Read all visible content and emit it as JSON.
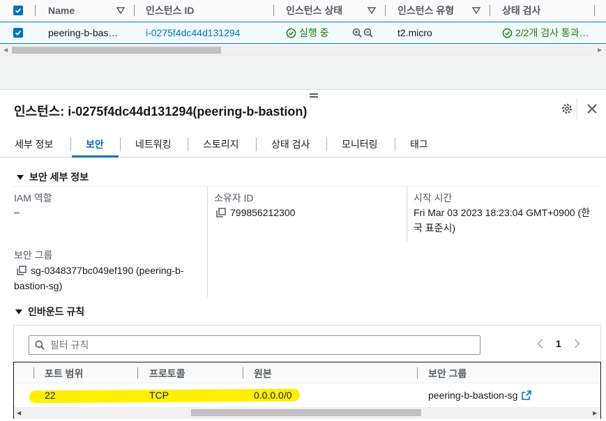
{
  "instances_table": {
    "columns": [
      "Name",
      "인스턴스 ID",
      "인스턴스 상태",
      "인스턴스 유형",
      "상태 검사"
    ],
    "row": {
      "name": "peering-b-bas…",
      "instance_id": "i-0275f4dc44d131294",
      "state": "실행 중",
      "type": "t2.micro",
      "status_check": "2/2개 검사 통과…"
    }
  },
  "panel": {
    "title": "인스턴스: i-0275f4dc44d131294(peering-b-bastion)"
  },
  "tabs": [
    {
      "label": "세부 정보"
    },
    {
      "label": "보안"
    },
    {
      "label": "네트워킹"
    },
    {
      "label": "스토리지"
    },
    {
      "label": "상태 검사"
    },
    {
      "label": "모니터링"
    },
    {
      "label": "태그"
    }
  ],
  "security_details": {
    "heading": "보안 세부 정보",
    "iam_role_label": "IAM 역할",
    "iam_role_value": "–",
    "owner_id_label": "소유자 ID",
    "owner_id_value": "799856212300",
    "launch_time_label": "시작 시간",
    "launch_time_line1": "Fri Mar 03 2023 18:23:04 GMT+0900 (한",
    "launch_time_line2": "국 표준시)",
    "security_groups_label": "보안 그룹",
    "security_group_line1": "sg-0348377bc049ef190 (peering-b-",
    "security_group_line2": "bastion-sg)"
  },
  "inbound_rules": {
    "heading": "인바운드 규칙",
    "filter_placeholder": "필터 규칙",
    "page": "1",
    "columns": [
      "포트 범위",
      "프로토콜",
      "원본",
      "보안 그룹"
    ],
    "rows": [
      {
        "port": "22",
        "protocol": "TCP",
        "source": "0.0.0.0/0",
        "security_group": "peering-b-bastion-sg"
      }
    ]
  },
  "colors": {
    "link": "#0073bb",
    "success": "#1d8102",
    "highlight": "#ffef00"
  }
}
